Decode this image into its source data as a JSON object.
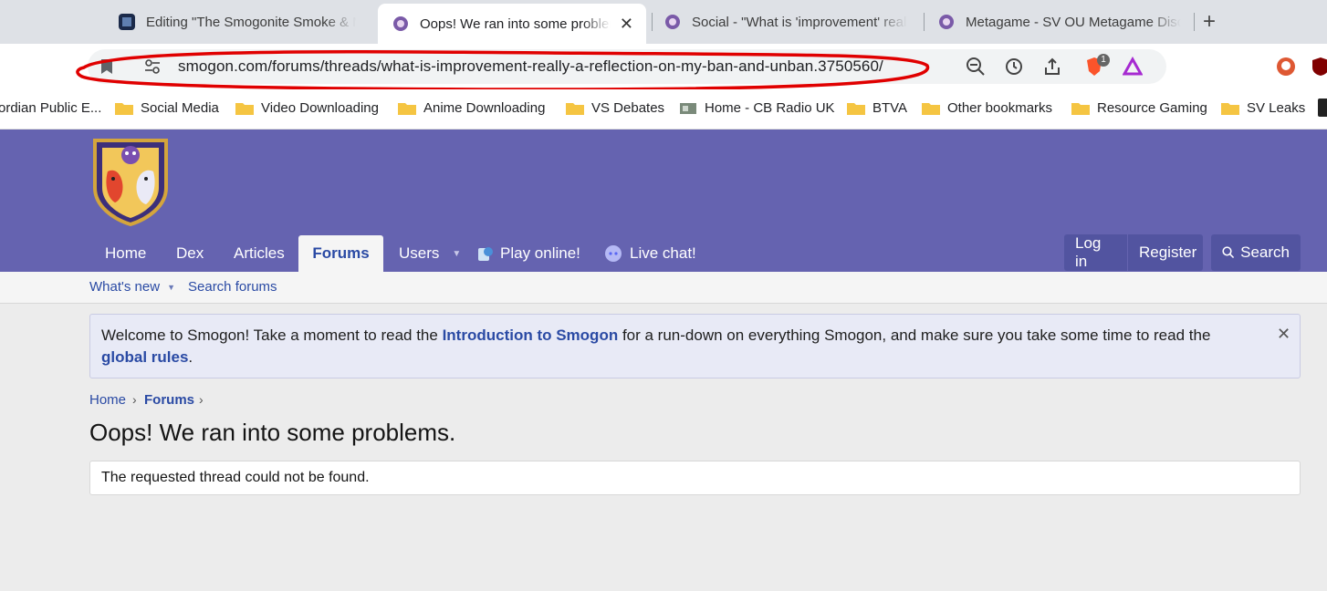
{
  "tabs": [
    {
      "title": "Editing \"The Smogonite Smoke & Mirrors\""
    },
    {
      "title": "Oops! We ran into some problems. | Smogon",
      "close": "✕"
    },
    {
      "title": "Social - \"What is 'improvement' really?\""
    },
    {
      "title": "Metagame - SV OU Metagame Discussion"
    }
  ],
  "new_tab": "+",
  "url": "smogon.com/forums/threads/what-is-improvement-really-a-reflection-on-my-ban-and-unban.3750560/",
  "extension_badge": "1",
  "bookmarks": [
    "ordian Public E...",
    "Social Media",
    "Video Downloading",
    "Anime Downloading",
    "VS Debates",
    "Home - CB Radio UK",
    "BTVA",
    "Other bookmarks",
    "Resource Gaming",
    "SV Leaks"
  ],
  "nav": {
    "home": "Home",
    "dex": "Dex",
    "articles": "Articles",
    "forums": "Forums",
    "users": "Users",
    "play": "Play online!",
    "chat": "Live chat!",
    "login": "Log in",
    "register": "Register",
    "search": "Search"
  },
  "subnav": {
    "whats_new": "What's new",
    "search_forums": "Search forums"
  },
  "notice": {
    "pre": "Welcome to Smogon! Take a moment to read the ",
    "link1": "Introduction to Smogon",
    "mid": " for a run-down on everything Smogon, and make sure you take some time to read the ",
    "link2": "global rules",
    "post": ".",
    "close": "✕"
  },
  "breadcrumb": {
    "home": "Home",
    "forums": "Forums",
    "sep": "›"
  },
  "page_title": "Oops! We ran into some problems.",
  "message": "The requested thread could not be found.",
  "colors": {
    "header": "#6563b0",
    "link": "#2a4aa4",
    "annotation": "#e00000"
  }
}
